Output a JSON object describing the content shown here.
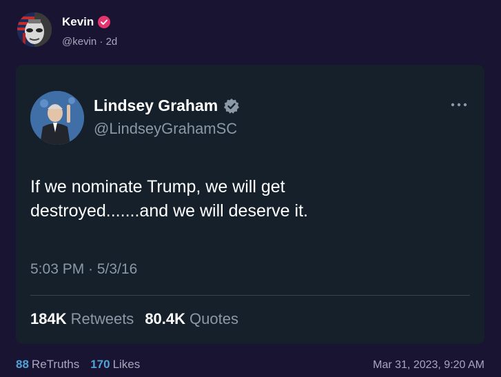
{
  "author": {
    "name": "Kevin",
    "handle": "@kevin",
    "separator": "·",
    "age": "2d",
    "verified_icon": "verified-badge-icon",
    "verified_color": "#e5356f"
  },
  "embed": {
    "name": "Lindsey Graham",
    "handle": "@LindseyGrahamSC",
    "verified_icon": "verified-badge-icon",
    "more_icon": "more-options-icon",
    "text_line1": "If we nominate Trump, we will get",
    "text_line2": "destroyed.......and we will deserve it.",
    "timestamp": "5:03 PM · 5/3/16",
    "retweets_count": "184K",
    "retweets_label": "Retweets",
    "quotes_count": "80.4K",
    "quotes_label": "Quotes"
  },
  "footer": {
    "retruths_count": "88",
    "retruths_label": "ReTruths",
    "likes_count": "170",
    "likes_label": "Likes",
    "date": "Mar 31, 2023, 9:20 AM"
  },
  "colors": {
    "page_bg": "#1a1433",
    "card_bg": "#15202b",
    "accent": "#4fa3d8",
    "muted": "#8b98a5"
  }
}
